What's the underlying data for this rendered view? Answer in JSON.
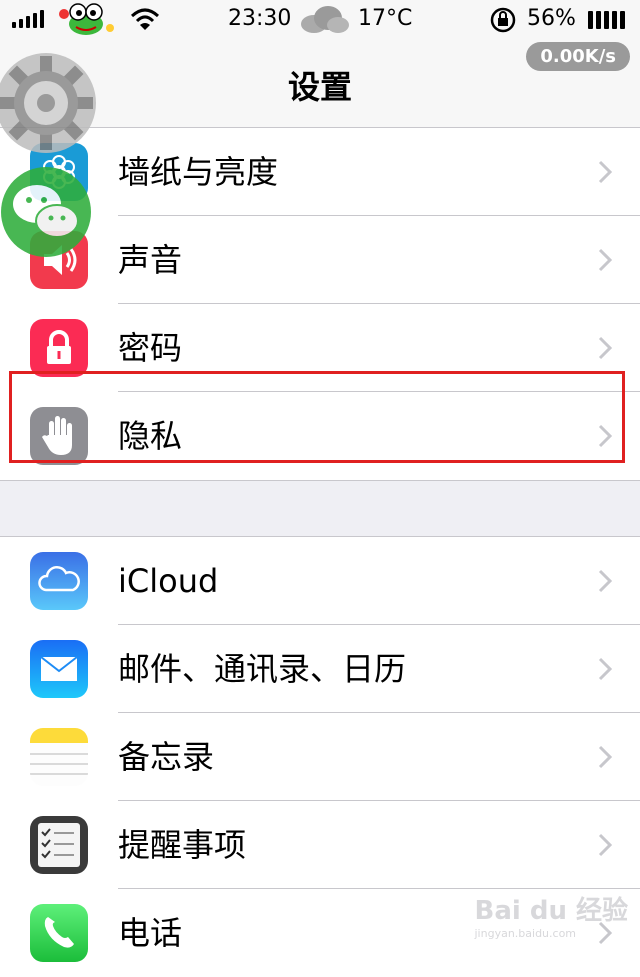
{
  "status_bar": {
    "time": "23:30",
    "temperature": "17°C",
    "battery_percent": "56%",
    "network_speed": "0.00K/s"
  },
  "nav": {
    "title": "设置"
  },
  "group1": [
    {
      "label": "墙纸与亮度",
      "icon": "wallpaper-icon",
      "color": "#1a9bd6"
    },
    {
      "label": "声音",
      "icon": "speaker-icon",
      "color": "#f23a4d"
    },
    {
      "label": "密码",
      "icon": "lock-icon",
      "color": "#fb2b54"
    },
    {
      "label": "隐私",
      "icon": "hand-icon",
      "color": "#8e8e93"
    }
  ],
  "group2": [
    {
      "label": "iCloud",
      "icon": "cloud-icon",
      "color": "#3c8ef0"
    },
    {
      "label": "邮件、通讯录、日历",
      "icon": "mail-icon",
      "color": "#1e8cf5"
    },
    {
      "label": "备忘录",
      "icon": "notes-icon",
      "color": "#fddb3a"
    },
    {
      "label": "提醒事项",
      "icon": "reminders-icon",
      "color": "#3a3a3a"
    },
    {
      "label": "电话",
      "icon": "phone-icon",
      "color": "#2bd94f"
    }
  ],
  "watermark": {
    "brand": "Bai du 经验",
    "url": "jingyan.baidu.com"
  },
  "highlight_color": "#e02020"
}
